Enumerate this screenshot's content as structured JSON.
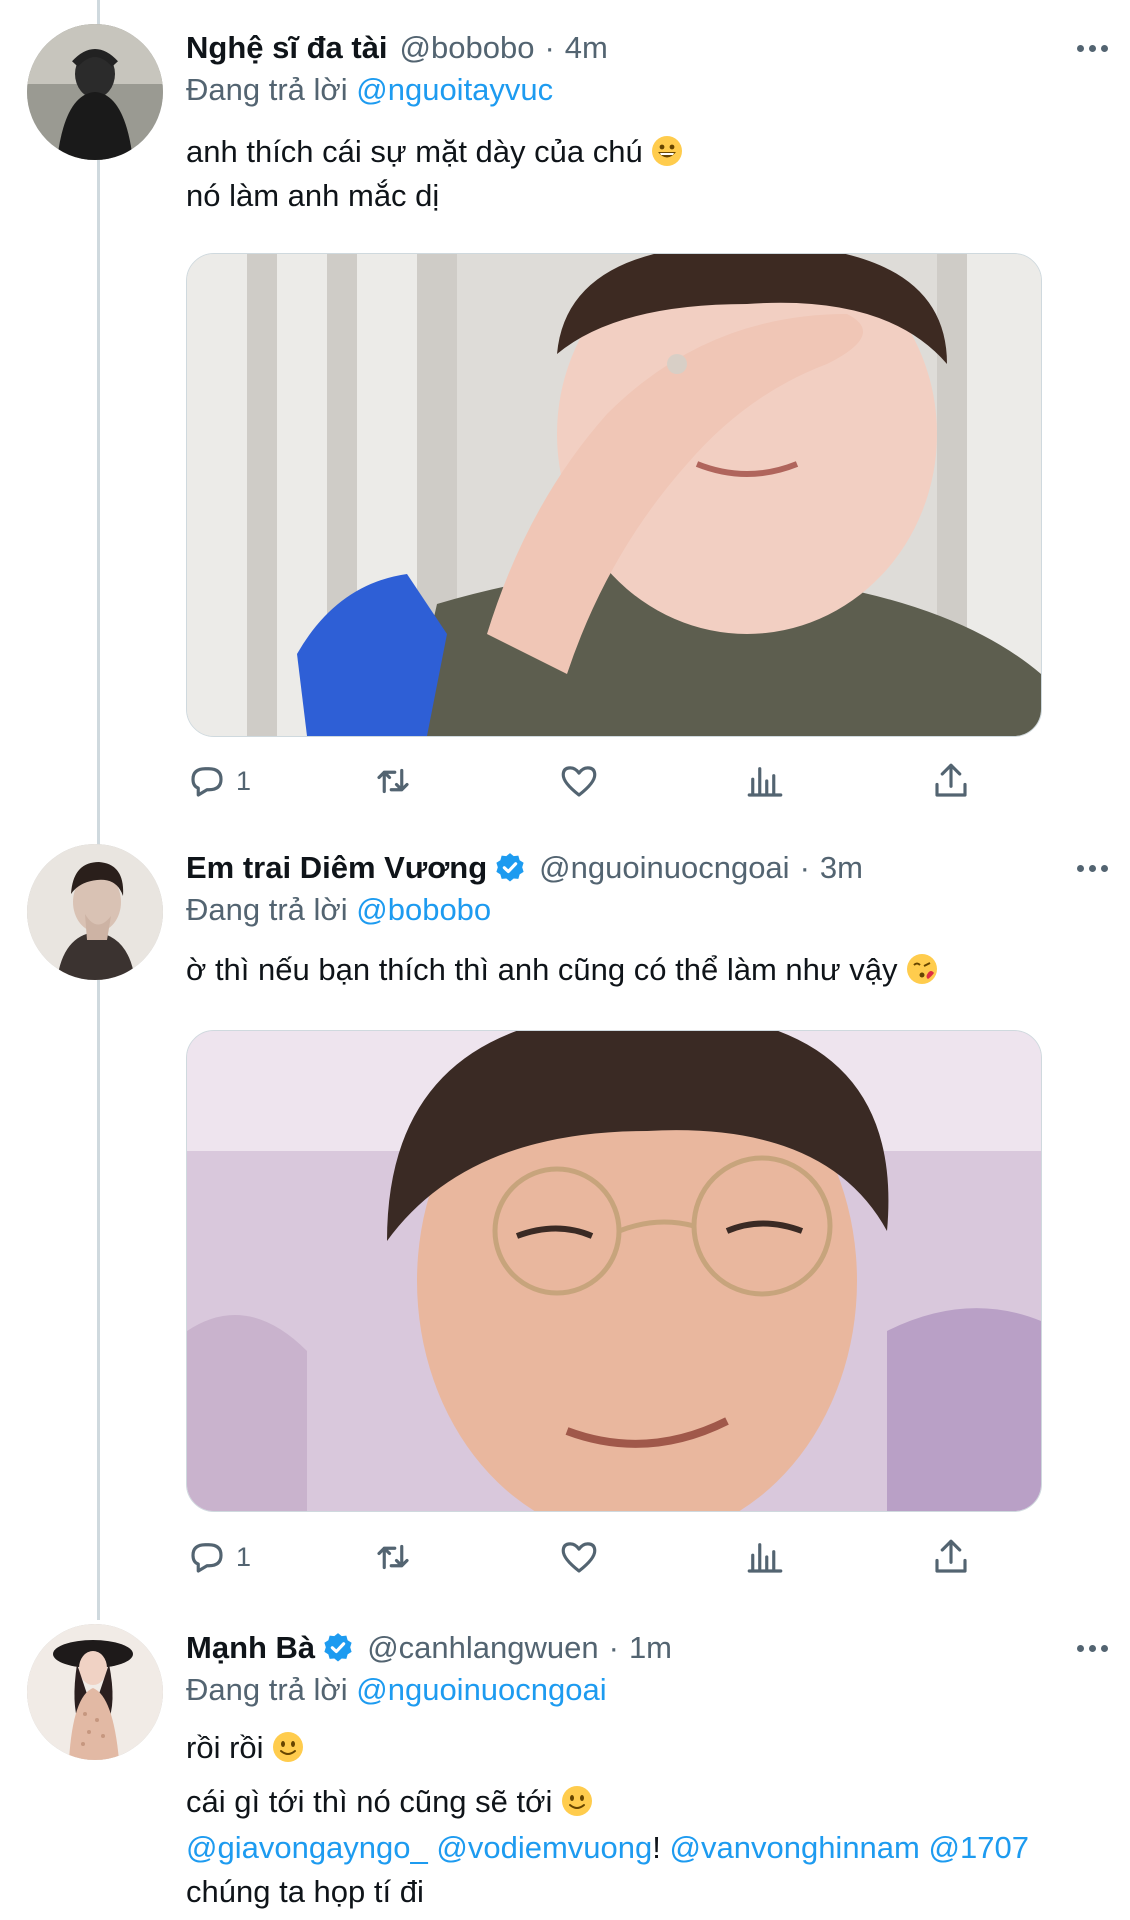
{
  "tweets": [
    {
      "name": "Nghệ sĩ đa tài",
      "verified": false,
      "handle": "@bobobo",
      "time": "4m",
      "replying_label": "Đang trả lời",
      "replying_to": "@nguoitayvuc",
      "lines": [
        "anh thích cái sự mặt dày của chú",
        "nó làm anh mắc dị"
      ],
      "emoji": "grinning-face",
      "reply_count": "1"
    },
    {
      "name": "Em trai Diêm Vương",
      "verified": true,
      "handle": "@nguoinuocngoai",
      "time": "3m",
      "replying_label": "Đang trả lời",
      "replying_to": "@bobobo",
      "lines": [
        "ờ thì nếu bạn thích thì anh cũng có thể làm như vậy"
      ],
      "emoji": "face-blowing-kiss",
      "reply_count": "1"
    },
    {
      "name": "Mạnh Bà",
      "verified": true,
      "handle": "@canhlangwuen",
      "time": "1m",
      "replying_label": "Đang trả lời",
      "replying_to": "@nguoinuocngoai",
      "lines": [
        "rồi rồi",
        "cái gì tới thì nó cũng sẽ tới",
        "chúng ta họp tí đi"
      ],
      "mentions": [
        "@giavongayngo_",
        "@vodiemvuong",
        "!",
        "@vanvonghinnam",
        "@1707"
      ],
      "emoji": "slightly-smiling-face"
    }
  ],
  "separator": "·",
  "colors": {
    "accent": "#1d9bf0",
    "secondary": "#536471",
    "text": "#0f1419",
    "thread_line": "#cfd9de"
  }
}
